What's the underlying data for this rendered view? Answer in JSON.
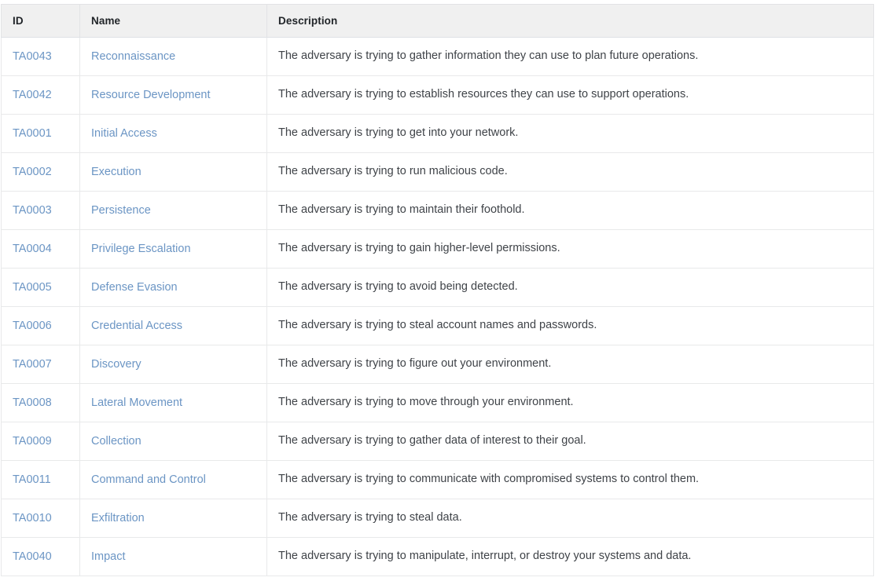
{
  "table": {
    "columns": [
      {
        "key": "id",
        "label": "ID"
      },
      {
        "key": "name",
        "label": "Name"
      },
      {
        "key": "description",
        "label": "Description"
      }
    ],
    "colors": {
      "link": "#6b95c4",
      "header_background": "#f0f0f0",
      "header_text": "#212529",
      "body_text": "#3f4348",
      "border": "#e8e9ea"
    },
    "rows": [
      {
        "id": "TA0043",
        "name": "Reconnaissance",
        "description": "The adversary is trying to gather information they can use to plan future operations."
      },
      {
        "id": "TA0042",
        "name": "Resource Development",
        "description": "The adversary is trying to establish resources they can use to support operations."
      },
      {
        "id": "TA0001",
        "name": "Initial Access",
        "description": "The adversary is trying to get into your network."
      },
      {
        "id": "TA0002",
        "name": "Execution",
        "description": "The adversary is trying to run malicious code."
      },
      {
        "id": "TA0003",
        "name": "Persistence",
        "description": "The adversary is trying to maintain their foothold."
      },
      {
        "id": "TA0004",
        "name": "Privilege Escalation",
        "description": "The adversary is trying to gain higher-level permissions."
      },
      {
        "id": "TA0005",
        "name": "Defense Evasion",
        "description": "The adversary is trying to avoid being detected."
      },
      {
        "id": "TA0006",
        "name": "Credential Access",
        "description": "The adversary is trying to steal account names and passwords."
      },
      {
        "id": "TA0007",
        "name": "Discovery",
        "description": "The adversary is trying to figure out your environment."
      },
      {
        "id": "TA0008",
        "name": "Lateral Movement",
        "description": "The adversary is trying to move through your environment."
      },
      {
        "id": "TA0009",
        "name": "Collection",
        "description": "The adversary is trying to gather data of interest to their goal."
      },
      {
        "id": "TA0011",
        "name": "Command and Control",
        "description": "The adversary is trying to communicate with compromised systems to control them."
      },
      {
        "id": "TA0010",
        "name": "Exfiltration",
        "description": "The adversary is trying to steal data."
      },
      {
        "id": "TA0040",
        "name": "Impact",
        "description": "The adversary is trying to manipulate, interrupt, or destroy your systems and data."
      }
    ]
  }
}
